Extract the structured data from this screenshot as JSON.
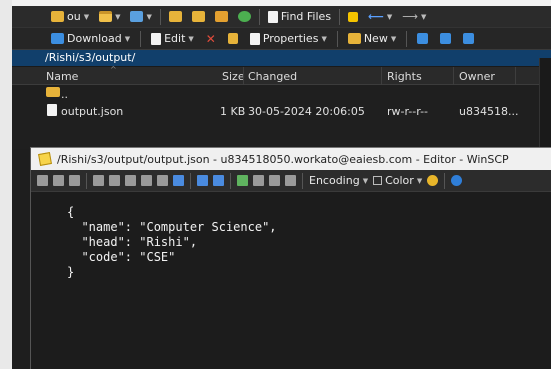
{
  "toolbar1": {
    "drive_label": "ou",
    "find_files": "Find Files"
  },
  "toolbar2": {
    "download": "Download",
    "edit": "Edit",
    "properties": "Properties",
    "new": "New"
  },
  "path": "/Rishi/s3/output/",
  "columns": {
    "name": "Name",
    "size": "Size",
    "changed": "Changed",
    "rights": "Rights",
    "owner": "Owner"
  },
  "files": [
    {
      "name": "..",
      "size": "",
      "changed": "",
      "rights": "",
      "owner": ""
    },
    {
      "name": "output.json",
      "size": "1 KB",
      "changed": "30-05-2024 20:06:05",
      "rights": "rw-r--r--",
      "owner": "u834518..."
    }
  ],
  "editor": {
    "title": "/Rishi/s3/output/output.json - u834518050.workato@eaiesb.com - Editor - WinSCP",
    "encoding": "Encoding",
    "color": "Color",
    "code": "{\n  \"name\": \"Computer Science\",\n  \"head\": \"Rishi\",\n  \"code\": \"CSE\"\n}"
  }
}
